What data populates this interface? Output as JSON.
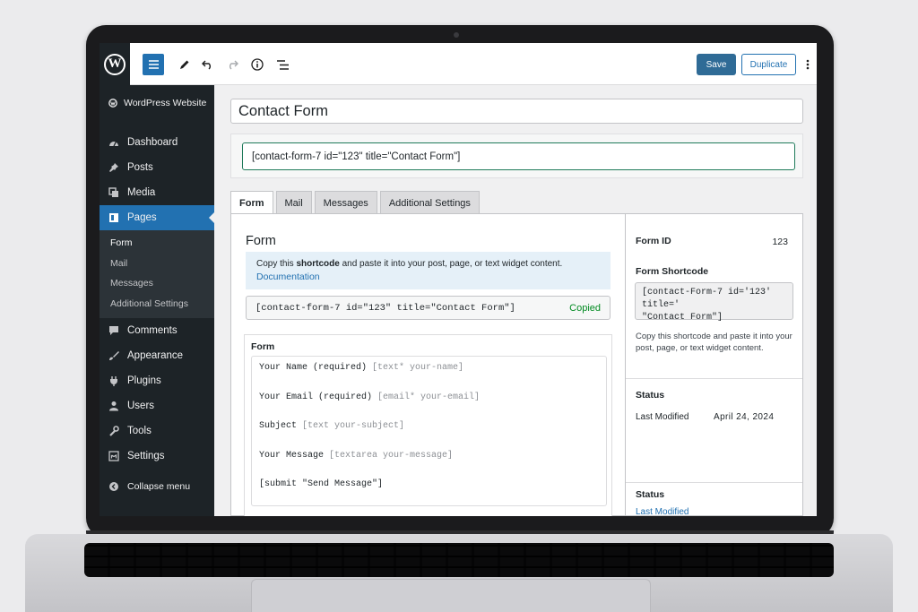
{
  "sidebar": {
    "site_name": "WordPress Website",
    "items": [
      {
        "label": "Dashboard",
        "icon": "dashboard-icon"
      },
      {
        "label": "Posts",
        "icon": "pin-icon"
      },
      {
        "label": "Media",
        "icon": "media-icon"
      },
      {
        "label": "Pages",
        "icon": "pages-icon",
        "active": true
      }
    ],
    "submenu": [
      "Form",
      "Mail",
      "Messages",
      "Additional Settings"
    ],
    "items_after": [
      {
        "label": "Comments",
        "icon": "comment-icon"
      },
      {
        "label": "Appearance",
        "icon": "brush-icon"
      },
      {
        "label": "Plugins",
        "icon": "plug-icon"
      },
      {
        "label": "Users",
        "icon": "user-icon"
      },
      {
        "label": "Tools",
        "icon": "wrench-icon"
      },
      {
        "label": "Settings",
        "icon": "settings-icon"
      }
    ],
    "collapse_label": "Collapse menu"
  },
  "toolbar": {
    "save_label": "Save",
    "duplicate_label": "Duplicate"
  },
  "editor": {
    "title": "Contact Form",
    "shortcode": "[contact-form-7 id=\"123\" title=\"Contact Form\"]"
  },
  "tabs": [
    "Form",
    "Mail",
    "Messages",
    "Additional Settings"
  ],
  "panel": {
    "heading": "Form",
    "notice_pre": "Copy this ",
    "notice_bold": "shortcode",
    "notice_post": " and paste it into your post, page, or text widget content.",
    "notice_link": "Documentation",
    "code": "[contact-form-7 id=\"123\" title=\"Contact Form\"]",
    "copied_label": "Copied",
    "form_label": "Form",
    "form_lines": [
      {
        "text": "Your Name (required) ",
        "tag": "[text* your-name]"
      },
      {
        "text": "Your Email (required) ",
        "tag": "[email* your-email]"
      },
      {
        "text": "Subject ",
        "tag": "[text your-subject]"
      },
      {
        "text": "Your Message ",
        "tag": "[textarea your-message]"
      },
      {
        "text": "[submit \"Send Message\"]",
        "tag": ""
      }
    ]
  },
  "meta": {
    "form_id_label": "Form ID",
    "form_id_value": "123",
    "shortcode_label": "Form Shortcode",
    "shortcode_line1": "[contact-Form-7 id='123' title='",
    "shortcode_line2": "\"Contact Form\"]",
    "help_text": "Copy this shortcode and paste it into your post, page, or text widget content.",
    "status_label": "Status",
    "last_modified_label": "Last Modified",
    "last_modified_value": "April 24, 2024",
    "status2_label": "Status",
    "last_modified_link": "Last Modified"
  }
}
